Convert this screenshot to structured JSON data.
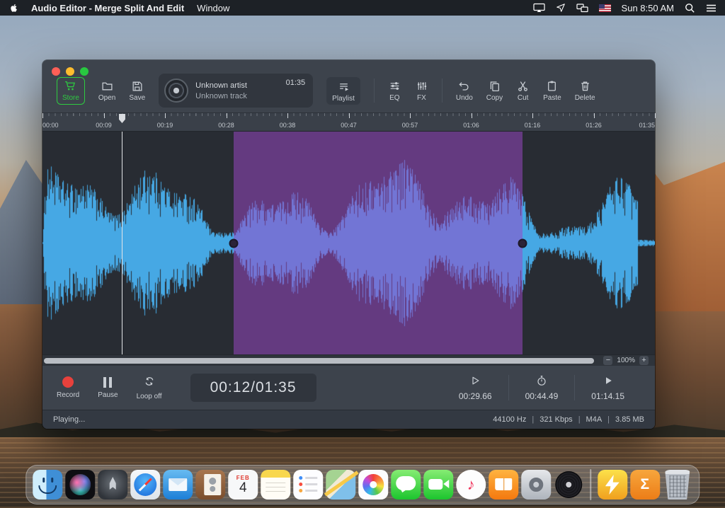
{
  "menubar": {
    "app_name": "Audio Editor - Merge Split And Edit",
    "window_menu": "Window",
    "clock": "Sun 8:50 AM"
  },
  "window": {
    "toolbar": {
      "store_label": "Store",
      "open_label": "Open",
      "save_label": "Save",
      "now_playing": {
        "artist": "Unknown artist",
        "track": "Unknown track",
        "duration": "01:35"
      },
      "playlist_label": "Playlist",
      "eq_label": "EQ",
      "fx_label": "FX",
      "undo_label": "Undo",
      "copy_label": "Copy",
      "cut_label": "Cut",
      "paste_label": "Paste",
      "delete_label": "Delete"
    },
    "ruler": {
      "labels": [
        "00:00",
        "00:09",
        "00:19",
        "00:28",
        "00:38",
        "00:47",
        "00:57",
        "01:06",
        "01:16",
        "01:26",
        "01:35"
      ]
    },
    "waveform": {
      "color": "#46a8e4",
      "selection_color": "#9b46c8",
      "playhead_pct": 13.0,
      "selection_start_pct": 31.2,
      "selection_end_pct": 78.4
    },
    "zoom": {
      "minus": "−",
      "level": "100%",
      "plus": "+"
    },
    "transport": {
      "record_label": "Record",
      "pause_label": "Pause",
      "loop_label": "Loop off",
      "time_display": "00:12/01:35",
      "markers": [
        {
          "icon": "play-outline-icon",
          "value": "00:29.66"
        },
        {
          "icon": "stopwatch-icon",
          "value": "00:44.49"
        },
        {
          "icon": "play-filled-icon",
          "value": "01:14.15"
        }
      ]
    },
    "statusbar": {
      "left": "Playing...",
      "sep": "|",
      "items": [
        "44100 Hz",
        "321 Kbps",
        "M4A",
        "3.85 MB"
      ]
    }
  },
  "accent_colors": {
    "store_green": "#2ecc40",
    "record_red": "#e8413c"
  },
  "dock": {
    "items": [
      {
        "name": "finder-icon",
        "cls": "finder"
      },
      {
        "name": "siri-icon",
        "cls": "siri"
      },
      {
        "name": "launchpad-icon",
        "cls": "launchpad"
      },
      {
        "name": "safari-icon",
        "cls": "safari"
      },
      {
        "name": "mail-icon",
        "cls": "mail"
      },
      {
        "name": "contacts-icon",
        "cls": "contacts"
      },
      {
        "name": "calendar-icon",
        "cls": "calendar",
        "month": "FEB",
        "day": "4"
      },
      {
        "name": "notes-icon",
        "cls": "notes"
      },
      {
        "name": "reminders-icon",
        "cls": "reminders"
      },
      {
        "name": "maps-icon",
        "cls": "maps"
      },
      {
        "name": "photos-icon",
        "cls": "photos"
      },
      {
        "name": "messages-icon",
        "cls": "messages"
      },
      {
        "name": "facetime-icon",
        "cls": "facetime"
      },
      {
        "name": "itunes-icon",
        "cls": "itunes",
        "glyph": "♪"
      },
      {
        "name": "ibooks-icon",
        "cls": "ibooks"
      },
      {
        "name": "system-preferences-icon",
        "cls": "sysprefs"
      },
      {
        "name": "vinyl-app-icon",
        "cls": "vinyl"
      },
      {
        "name": "dock-separator",
        "cls": "separator"
      },
      {
        "name": "lightning-app-icon",
        "cls": "flash"
      },
      {
        "name": "sigma-app-icon",
        "cls": "sigma",
        "glyph": "Σ"
      },
      {
        "name": "trash-icon",
        "cls": "trash"
      }
    ]
  }
}
